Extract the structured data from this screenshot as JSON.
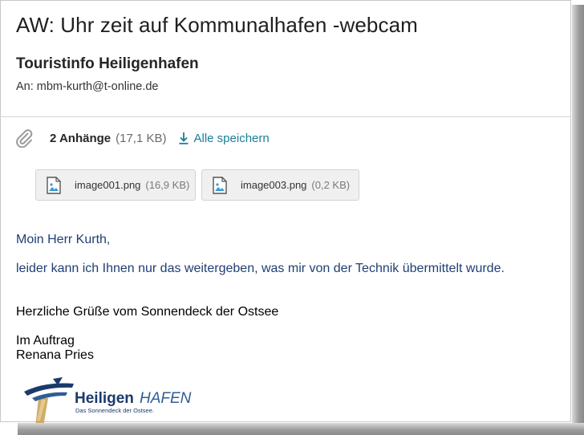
{
  "email": {
    "subject": "AW: Uhr zeit auf Kommunalhafen -webcam",
    "sender": "Touristinfo Heiligenhafen",
    "to_label": "An:",
    "to_address": "mbm-kurth@t-online.de"
  },
  "attachments": {
    "count_label": "2 Anhänge",
    "total_size": "(17,1 KB)",
    "save_all_label": "Alle speichern",
    "files": [
      {
        "name": "image001.png",
        "size": "(16,9 KB)"
      },
      {
        "name": "image003.png",
        "size": "(0,2 KB)"
      }
    ]
  },
  "body": {
    "greeting": "Moin Herr Kurth,",
    "line1": "leider kann ich Ihnen nur das weitergeben, was mir von der Technik übermittelt wurde.",
    "closing": "Herzliche Grüße vom Sonnendeck der Ostsee",
    "sign1": "Im Auftrag",
    "sign2": "Renana Pries"
  },
  "logo": {
    "word1": "Heiligen",
    "word2": "HAFEN",
    "tagline": "Das Sonnendeck der Ostsee."
  },
  "colors": {
    "link": "#17809b",
    "body_blue": "#1f3f73",
    "logo_blue": "#1b3a6b",
    "logo_gold": "#c9a55a"
  },
  "icons": {
    "attachment": "paperclip-icon",
    "save_all": "download-icon",
    "file": "image-file-icon"
  }
}
